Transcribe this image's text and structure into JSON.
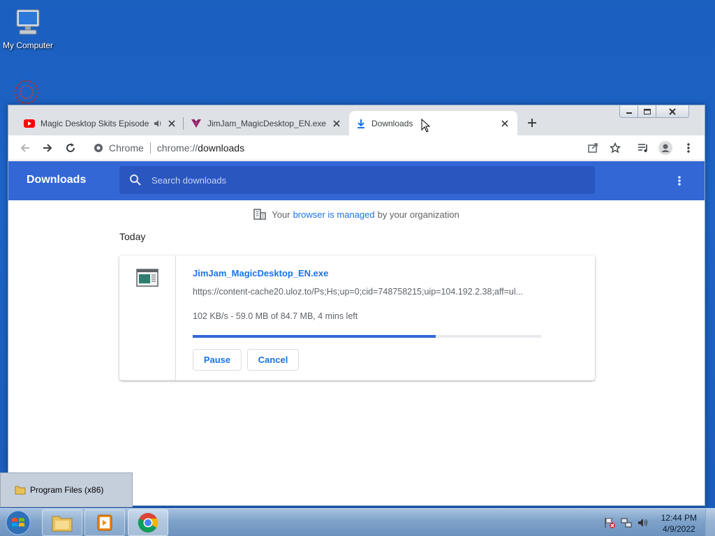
{
  "desktop": {
    "icons": [
      {
        "label": "My Computer"
      }
    ]
  },
  "browser": {
    "tabs": [
      {
        "title": "Magic Desktop Skits Episode",
        "icon": "youtube-icon",
        "audio": true
      },
      {
        "title": "JimJam_MagicDesktop_EN.exe | Ul",
        "icon": "uloz-icon"
      },
      {
        "title": "Downloads",
        "icon": "download-icon",
        "active": true
      }
    ],
    "omnibox": {
      "site": "Chrome",
      "url_scheme": "chrome://",
      "url_path": "downloads"
    }
  },
  "downloads_page": {
    "title": "Downloads",
    "search_placeholder": "Search downloads",
    "managed_prefix": "Your",
    "managed_link": "browser is managed",
    "managed_suffix": "by your organization",
    "section": "Today",
    "item": {
      "filename": "JimJam_MagicDesktop_EN.exe",
      "url": "https://content-cache20.uloz.to/Ps;Hs;up=0;cid=748758215;uip=104.192.2.38;aff=ul...",
      "status": "102 KB/s - 59.0 MB of 84.7 MB, 4 mins left",
      "progress_fraction": 0.6966,
      "pause_label": "Pause",
      "cancel_label": "Cancel"
    }
  },
  "popup": {
    "label": "Program Files (x86)"
  },
  "taskbar": {
    "clock_time": "12:44 PM",
    "clock_date": "4/9/2022"
  },
  "colors": {
    "accent": "#3367d6",
    "link": "#1a73e8",
    "desktop": "#1b5fbf"
  }
}
